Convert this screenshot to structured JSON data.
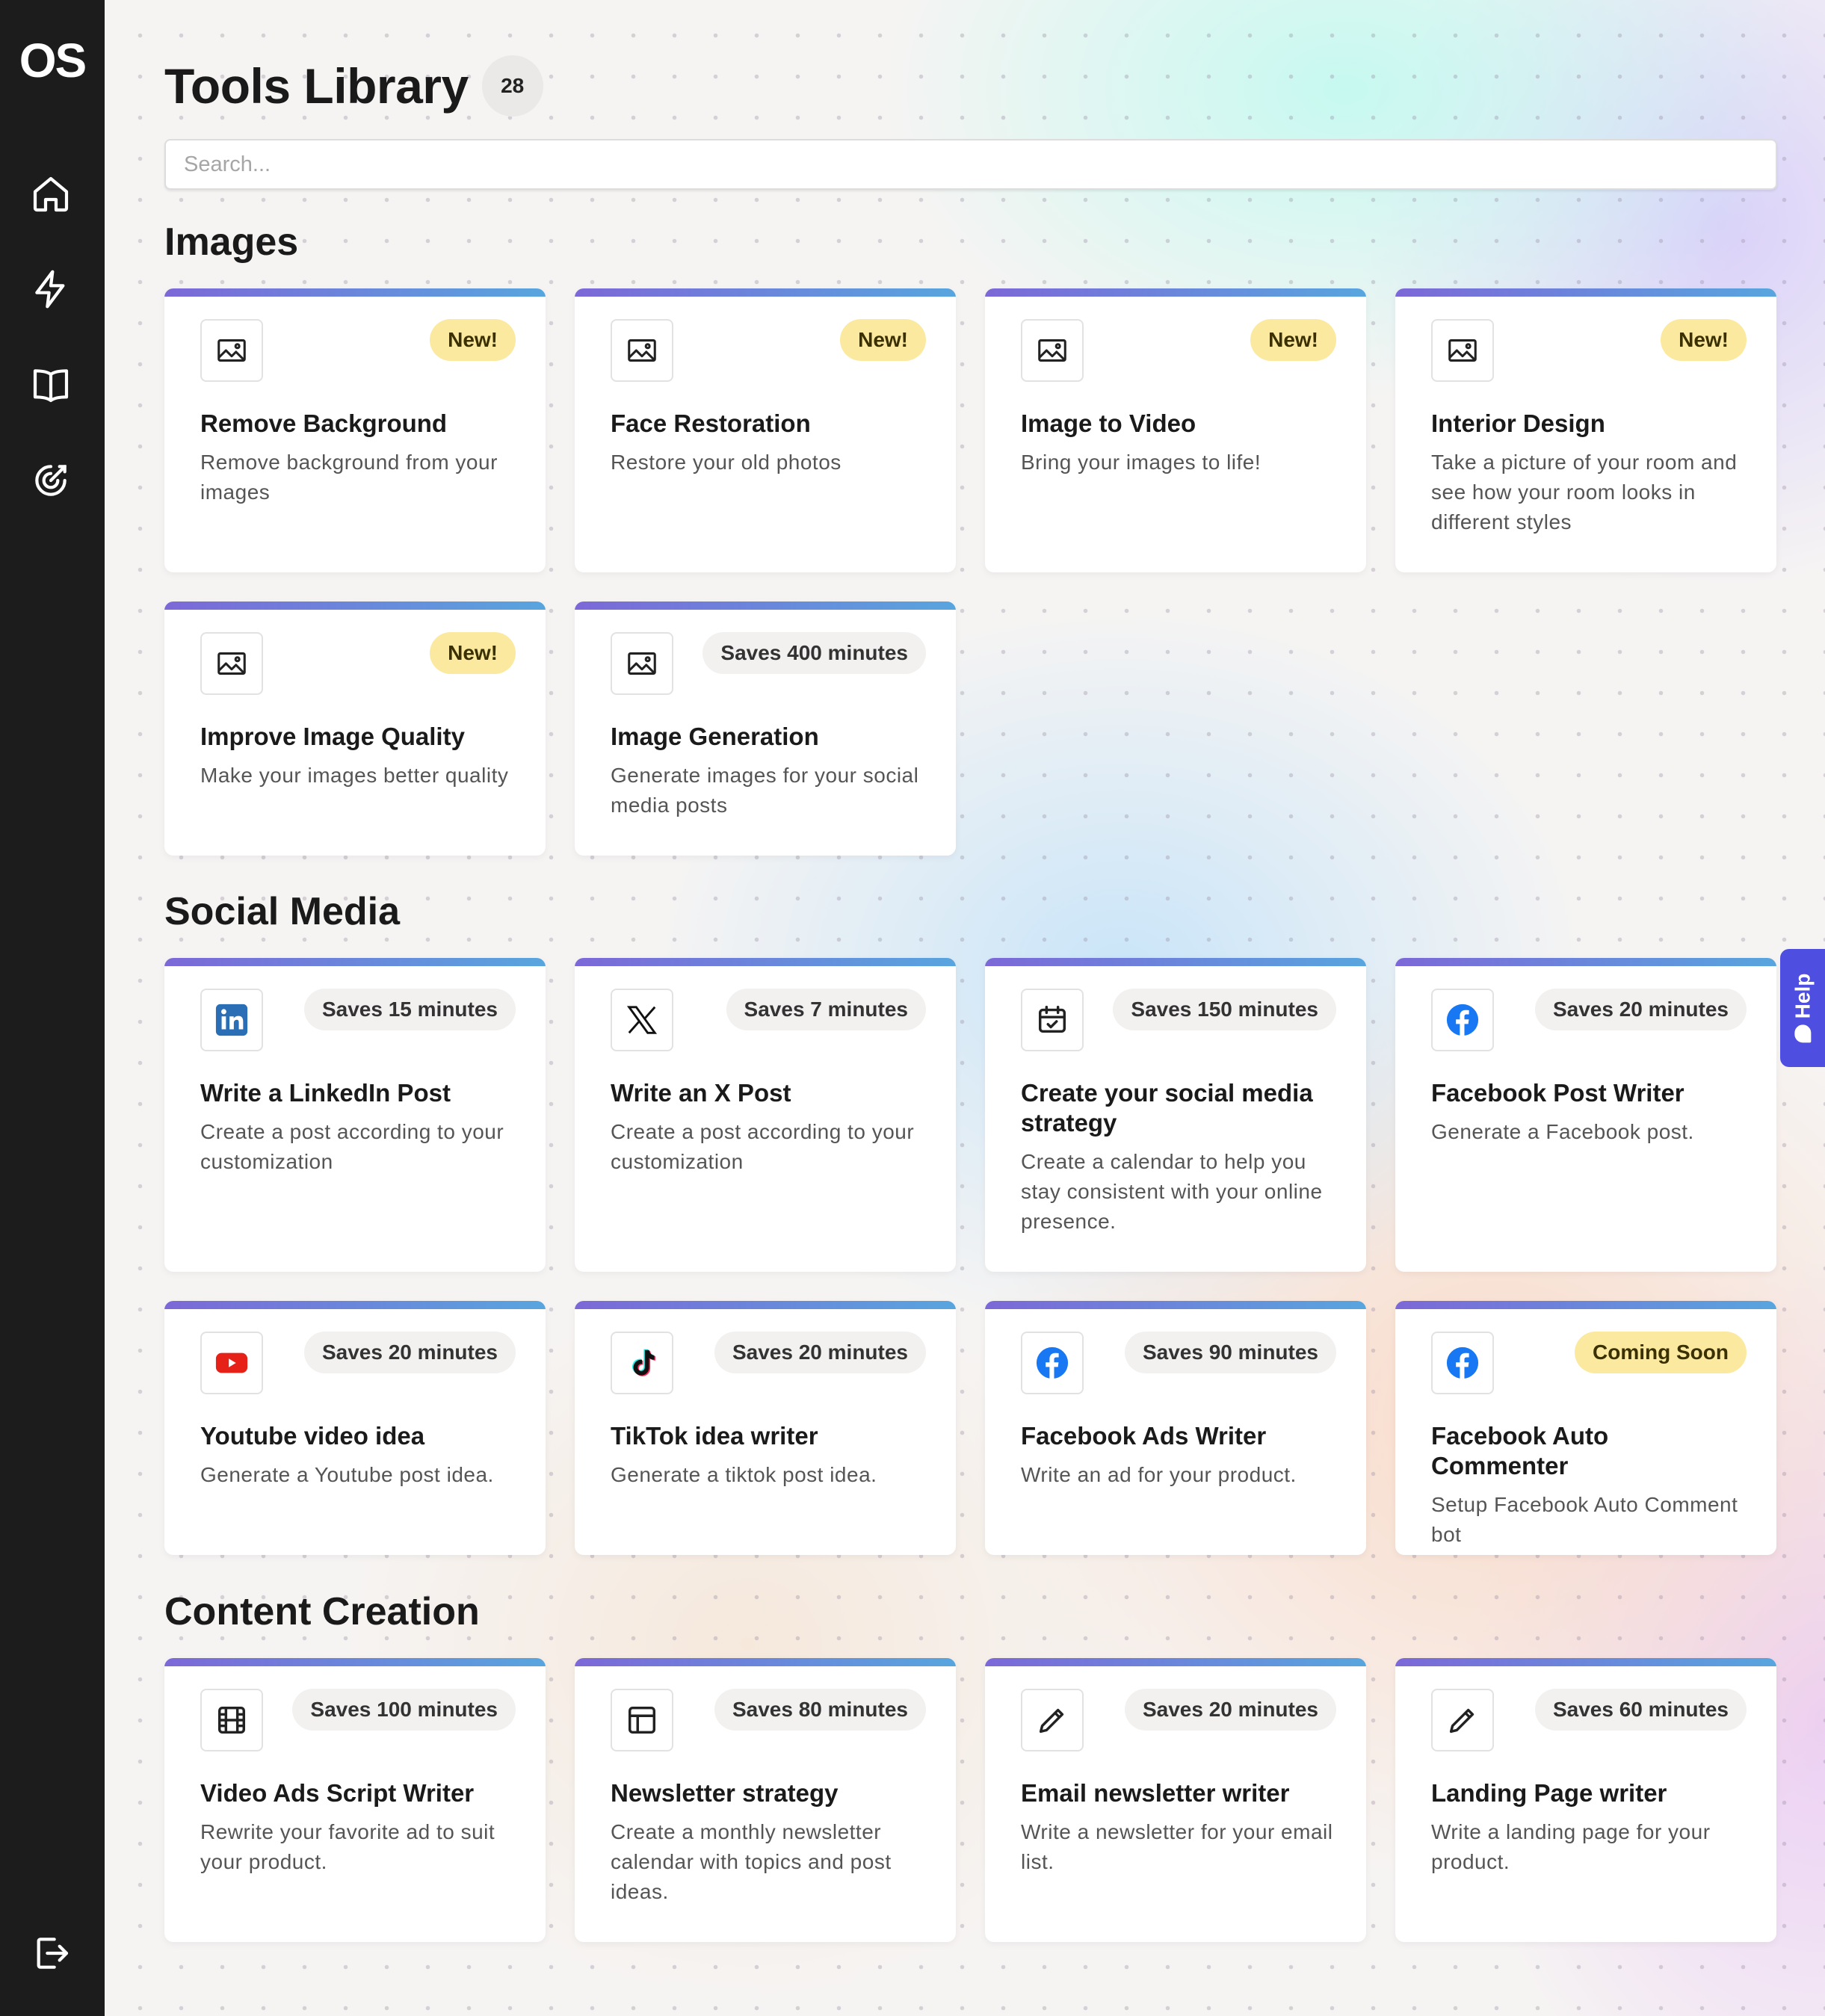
{
  "app": {
    "logo": "OS"
  },
  "sidebar": {
    "items": [
      {
        "icon": "home-icon"
      },
      {
        "icon": "lightning-icon"
      },
      {
        "icon": "book-icon"
      },
      {
        "icon": "target-icon"
      }
    ],
    "bottom": {
      "icon": "logout-icon"
    }
  },
  "header": {
    "title": "Tools Library",
    "count": "28"
  },
  "search": {
    "placeholder": "Search..."
  },
  "sections": {
    "images": {
      "title": "Images",
      "cards": [
        {
          "title": "Remove Background",
          "desc": "Remove background from your images",
          "badge": "New!",
          "icon": "image-icon"
        },
        {
          "title": "Face Restoration",
          "desc": "Restore your old photos",
          "badge": "New!",
          "icon": "image-icon"
        },
        {
          "title": "Image to Video",
          "desc": "Bring your images to life!",
          "badge": "New!",
          "icon": "image-icon"
        },
        {
          "title": "Interior Design",
          "desc": "Take a picture of your room and see how your room looks in different styles",
          "badge": "New!",
          "icon": "image-icon"
        },
        {
          "title": "Improve Image Quality",
          "desc": "Make your images better quality",
          "badge": "New!",
          "icon": "image-icon"
        },
        {
          "title": "Image Generation",
          "desc": "Generate images for your social media posts",
          "badge": "Saves 400 minutes",
          "icon": "image-icon"
        }
      ]
    },
    "social": {
      "title": "Social Media",
      "cards": [
        {
          "title": "Write a LinkedIn Post",
          "desc": "Create a post according to your customization",
          "badge": "Saves 15 minutes",
          "icon": "linkedin-icon"
        },
        {
          "title": "Write an X Post",
          "desc": "Create a post according to your customization",
          "badge": "Saves 7 minutes",
          "icon": "x-icon"
        },
        {
          "title": "Create your social media strategy",
          "desc": "Create a calendar to help you stay consistent with your online presence.",
          "badge": "Saves 150 minutes",
          "icon": "calendar-icon"
        },
        {
          "title": "Facebook Post Writer",
          "desc": "Generate a Facebook post.",
          "badge": "Saves 20 minutes",
          "icon": "facebook-icon"
        },
        {
          "title": "Youtube video idea",
          "desc": "Generate a Youtube post idea.",
          "badge": "Saves 20 minutes",
          "icon": "youtube-icon"
        },
        {
          "title": "TikTok idea writer",
          "desc": "Generate a tiktok post idea.",
          "badge": "Saves 20 minutes",
          "icon": "tiktok-icon"
        },
        {
          "title": "Facebook Ads Writer",
          "desc": "Write an ad for your product.",
          "badge": "Saves 90 minutes",
          "icon": "facebook-icon"
        },
        {
          "title": "Facebook Auto Commenter",
          "desc": "Setup Facebook Auto Comment bot",
          "badge": "Coming Soon",
          "icon": "facebook-icon"
        }
      ]
    },
    "content": {
      "title": "Content Creation",
      "cards": [
        {
          "title": "Video Ads Script Writer",
          "desc": "Rewrite your favorite ad to suit your product.",
          "badge": "Saves 100 minutes",
          "icon": "film-icon"
        },
        {
          "title": "Newsletter strategy",
          "desc": "Create a monthly newsletter calendar with topics and post ideas.",
          "badge": "Saves 80 minutes",
          "icon": "layout-icon"
        },
        {
          "title": "Email newsletter writer",
          "desc": "Write a newsletter for your email list.",
          "badge": "Saves 20 minutes",
          "icon": "pencil-icon"
        },
        {
          "title": "Landing Page writer",
          "desc": "Write a landing page for your product.",
          "badge": "Saves 60 minutes",
          "icon": "pencil-icon"
        }
      ]
    }
  },
  "help": {
    "label": "Help"
  },
  "colors": {
    "accent": "#4e4ee0",
    "new_badge": "#fbe9a0",
    "sidebar": "#1c1c1c"
  }
}
